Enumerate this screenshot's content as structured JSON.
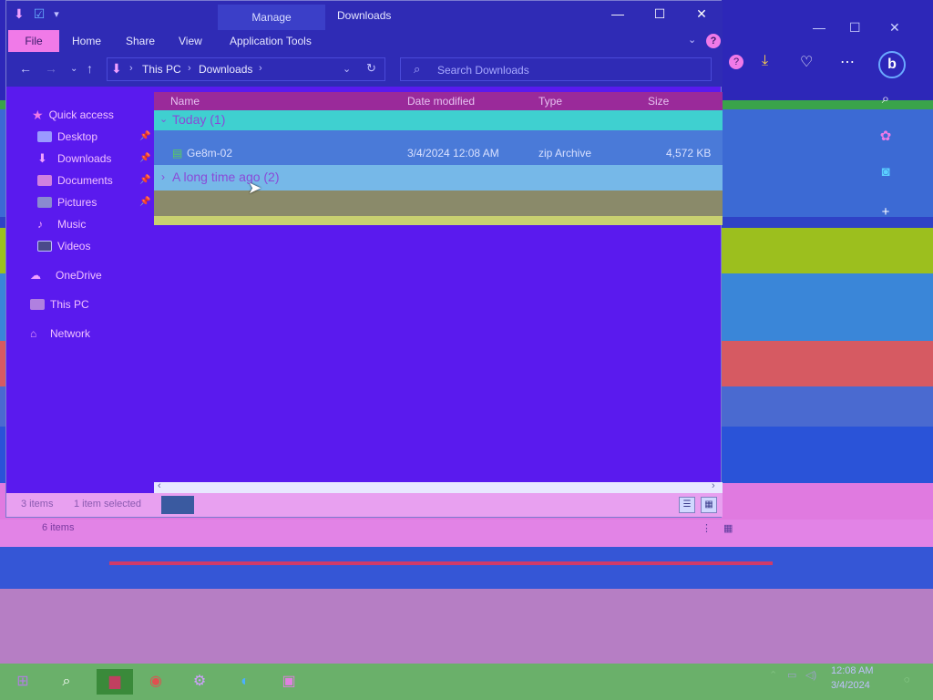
{
  "explorer": {
    "title": "Downloads",
    "manage_tab": "Manage",
    "ribbon_tabs": [
      "File",
      "Home",
      "Share",
      "View",
      "Application Tools"
    ],
    "help": "?",
    "address": {
      "crumbs": [
        "This PC",
        "Downloads"
      ]
    },
    "search_placeholder": "Search Downloads",
    "nav_pane": {
      "quick_access": "Quick access",
      "items": [
        "Desktop",
        "Downloads",
        "Documents",
        "Pictures",
        "Music",
        "Videos"
      ],
      "onedrive": "OneDrive",
      "this_pc": "This PC",
      "network": "Network"
    },
    "columns": {
      "name": "Name",
      "date_modified": "Date modified",
      "type": "Type",
      "size": "Size"
    },
    "groups": {
      "today": "Today (1)",
      "long_ago": "A long time ago (2)"
    },
    "file_row": {
      "name": "Ge8m-02",
      "date": "3/4/2024 12:08 AM",
      "type": "zip Archive",
      "size": "4,572 KB"
    },
    "status": {
      "items": "3 items",
      "selected": "1 item selected"
    }
  },
  "second_status": {
    "items": "6 items"
  },
  "colors": {
    "window_bg": "#5a1aee",
    "titlebar": "#2f2bb5",
    "file_tab": "#f07ae8",
    "column_header": "#9a2a9a"
  },
  "icons": {
    "downloads_qat": "down-arrow-icon",
    "help": "question-icon",
    "edge_profile": "bing-icon"
  },
  "taskbar": {
    "clock_time": "12:08 AM",
    "clock_date": "3/4/2024"
  }
}
